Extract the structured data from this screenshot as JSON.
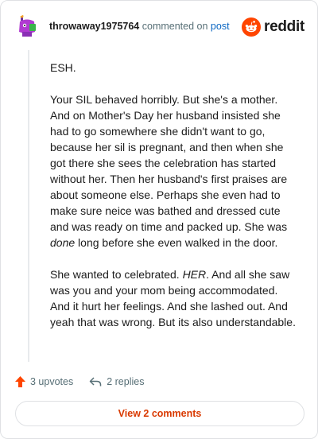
{
  "comment": {
    "username": "throwaway1975764",
    "action_text": "commented on",
    "post_link": "post",
    "paragraphs": [
      [
        {
          "text": "ESH."
        }
      ],
      [
        {
          "text": "Your SIL behaved horribly. But she's a mother. And on Mother's Day her husband insisted she had to go somewhere she didn't want to go, because her sil is pregnant, and then when she got there she sees the celebration has started without her. Then her husband's first praises are about someone else. Perhaps she even had to make sure neice was bathed and dressed cute and was ready on time and packed up. She was "
        },
        {
          "text": "done",
          "em": true
        },
        {
          "text": " long before she even walked in the door."
        }
      ],
      [
        {
          "text": "She wanted to celebrated. "
        },
        {
          "text": "HER",
          "em": true
        },
        {
          "text": ". And all she saw was you and your mom being accommodated. And it hurt her feelings. And she lashed out. And yeah that was wrong. But its also understandable."
        }
      ]
    ]
  },
  "brand": {
    "wordmark": "reddit",
    "logo_icon": "reddit-snoo-icon",
    "color": "#ff4500"
  },
  "actions": {
    "upvotes_label": "3 upvotes",
    "upvote_icon": "upvote-arrow-icon",
    "replies_label": "2 replies",
    "reply_icon": "reply-arrow-icon"
  },
  "footer": {
    "view_comments_label": "View 2 comments"
  },
  "colors": {
    "accent": "#d93900",
    "upvote": "#ff4500",
    "muted": "#576f76",
    "link": "#0a66c2"
  }
}
